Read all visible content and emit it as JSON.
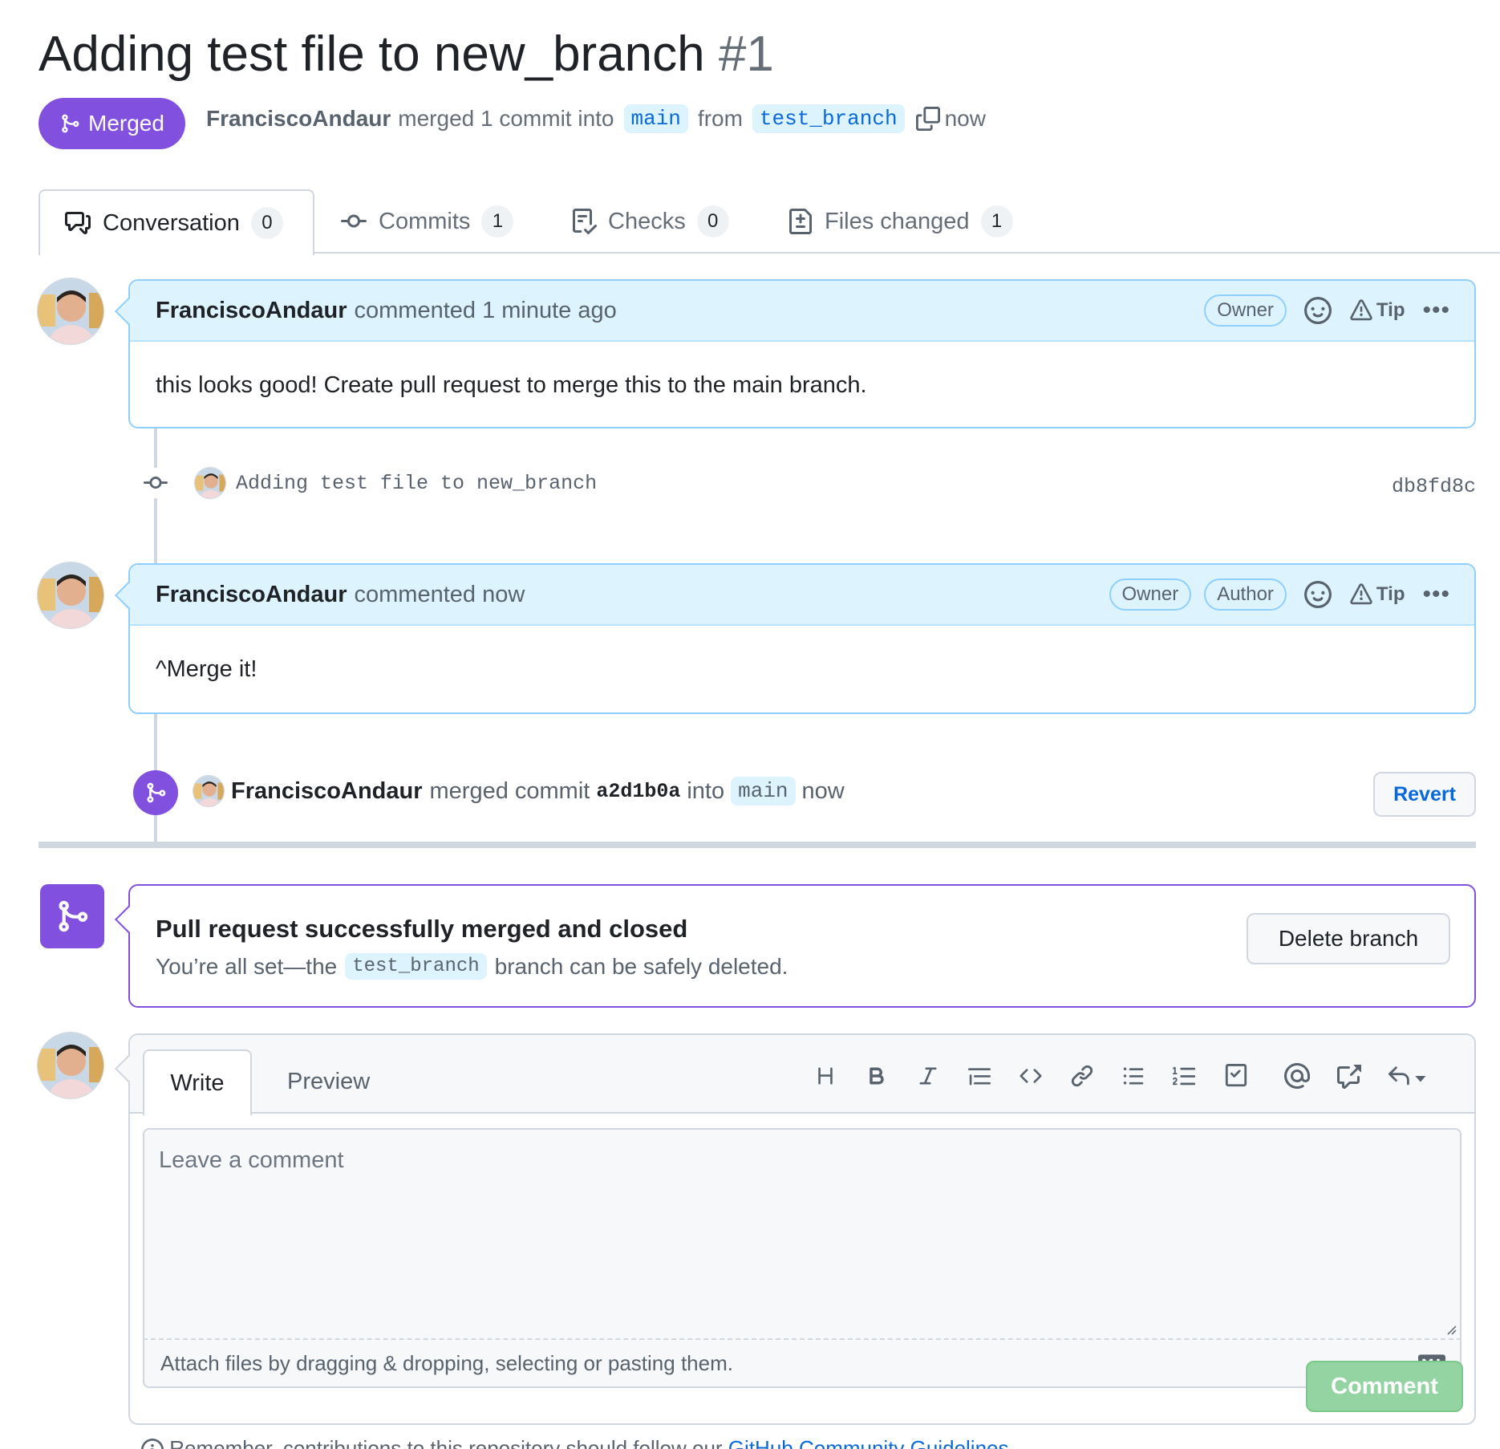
{
  "pr": {
    "title": "Adding test file to new_branch",
    "number": "#1",
    "state": "Merged",
    "author": "FranciscoAndaur",
    "summary": "merged 1 commit into",
    "base": "main",
    "from_text": "from",
    "head": "test_branch",
    "time": "now"
  },
  "tabs": [
    {
      "label": "Conversation",
      "count": "0"
    },
    {
      "label": "Commits",
      "count": "1"
    },
    {
      "label": "Checks",
      "count": "0"
    },
    {
      "label": "Files changed",
      "count": "1"
    }
  ],
  "comments": [
    {
      "author": "FranciscoAndaur",
      "action": "commented 1 minute ago",
      "roles": [
        "Owner"
      ],
      "tip": "Tip",
      "body": "this looks good! Create pull request to merge this to the main branch."
    },
    {
      "author": "FranciscoAndaur",
      "action": "commented now",
      "roles": [
        "Owner",
        "Author"
      ],
      "tip": "Tip",
      "body": "^Merge it!"
    }
  ],
  "commit": {
    "message": "Adding test file to new_branch",
    "sha": "db8fd8c"
  },
  "merge_event": {
    "author": "FranciscoAndaur",
    "text": "merged commit",
    "sha": "a2d1b0a",
    "into": "into",
    "branch": "main",
    "time": "now",
    "revert_label": "Revert"
  },
  "merged_box": {
    "title": "Pull request successfully merged and closed",
    "sub_before": "You’re all set—the",
    "branch": "test_branch",
    "sub_after": "branch can be safely deleted.",
    "delete_label": "Delete branch"
  },
  "editor": {
    "write_tab": "Write",
    "preview_tab": "Preview",
    "placeholder": "Leave a comment",
    "attach_text": "Attach files by dragging & dropping, selecting or pasting them.",
    "comment_label": "Comment",
    "toolbar_icons": [
      "heading-icon",
      "bold-icon",
      "italic-icon",
      "quote-icon",
      "code-icon",
      "link-icon",
      "unordered-list-icon",
      "ordered-list-icon",
      "task-list-icon",
      "mention-icon",
      "cross-reference-icon",
      "saved-replies-icon"
    ]
  },
  "footer": {
    "text": "Remember, contributions to this repository should follow our",
    "link": "GitHub Community Guidelines"
  },
  "colors": {
    "merged": "#8250df",
    "link": "#0969da",
    "comment_header": "#ddf4ff",
    "comment_btn": "#94d3a2"
  }
}
